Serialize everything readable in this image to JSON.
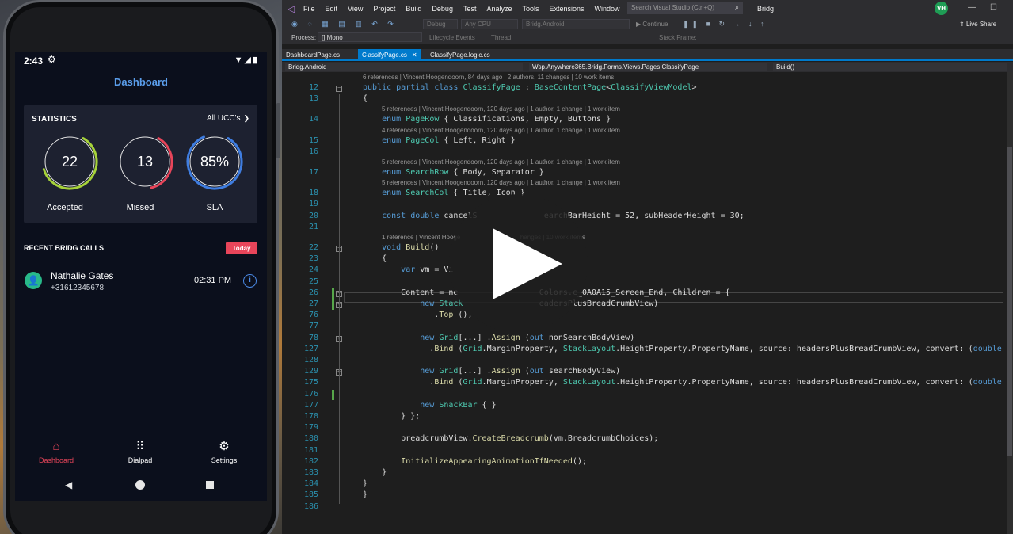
{
  "phone": {
    "status": {
      "time": "2:43",
      "signal_icons": "▼◢▮"
    },
    "app_title": "Dashboard",
    "statistics": {
      "title": "STATISTICS",
      "filter_label": "All UCC's",
      "gauges": [
        {
          "value": "22",
          "label": "Accepted",
          "fraction": 0.62,
          "color": "#a6d23a"
        },
        {
          "value": "13",
          "label": "Missed",
          "fraction": 0.38,
          "color": "#e8455a"
        },
        {
          "value": "85%",
          "label": "SLA",
          "fraction": 0.85,
          "color": "#3f7de0"
        }
      ]
    },
    "recent_calls": {
      "title": "RECENT BRIDG CALLS",
      "badge": "Today",
      "items": [
        {
          "name": "Nathalie Gates",
          "number": "+31612345678",
          "time": "02:31 PM"
        }
      ]
    },
    "nav": {
      "items": [
        {
          "label": "Dashboard",
          "icon": "home-icon"
        },
        {
          "label": "Dialpad",
          "icon": "dialpad-icon"
        },
        {
          "label": "Settings",
          "icon": "gear-icon"
        }
      ]
    }
  },
  "vs": {
    "menu": [
      "File",
      "Edit",
      "View",
      "Project",
      "Build",
      "Debug",
      "Test",
      "Analyze",
      "Tools",
      "Extensions",
      "Window",
      "Help"
    ],
    "search_placeholder": "Search Visual Studio (Ctrl+Q)",
    "solution_name": "Bridg",
    "user_initials": "VH",
    "toolbar": {
      "config": "Debug",
      "platform": "Any CPU",
      "project": "Bridg.Android",
      "continue": "Continue",
      "live_share": "Live Share"
    },
    "debugbar": {
      "process_label": "Process:",
      "process_value": "[] Mono",
      "lifecycle": "Lifecycle Events",
      "thread_label": "Thread:",
      "stack_frame": "Stack Frame:"
    },
    "tabs": [
      "DashboardPage.cs",
      "ClassifyPage.cs",
      "ClassifyPage.logic.cs"
    ],
    "active_tab": "ClassifyPage.cs",
    "navbar": {
      "project": "Bridg.Android",
      "type": "Wsp.Anywhere365.Bridg.Forms.Views.Pages.ClassifyPage",
      "member": "Build()"
    },
    "code": [
      {
        "kind": "lens",
        "text": "6 references | Vincent Hoogendoorn, 84 days ago | 2 authors, 11 changes | 10 work items",
        "indent": 0
      },
      {
        "kind": "code",
        "ln": "12",
        "text": "public partial class ClassifyPage : BaseContentPage<ClassifyViewModel>"
      },
      {
        "kind": "code",
        "ln": "13",
        "text": "{"
      },
      {
        "kind": "lens",
        "text": "5 references | Vincent Hoogendoorn, 120 days ago | 1 author, 1 change | 1 work item",
        "indent": 1
      },
      {
        "kind": "code",
        "ln": "14",
        "text": "    enum PageRow { Classifications, Empty, Buttons }"
      },
      {
        "kind": "lens",
        "text": "4 references | Vincent Hoogendoorn, 120 days ago | 1 author, 1 change | 1 work item",
        "indent": 1
      },
      {
        "kind": "code",
        "ln": "15",
        "text": "    enum PageCol { Left, Right }"
      },
      {
        "kind": "code",
        "ln": "16",
        "text": ""
      },
      {
        "kind": "lens",
        "text": "5 references | Vincent Hoogendoorn, 120 days ago | 1 author, 1 change | 1 work item",
        "indent": 1
      },
      {
        "kind": "code",
        "ln": "17",
        "text": "    enum SearchRow { Body, Separator }"
      },
      {
        "kind": "lens",
        "text": "5 references | Vincent Hoogendoorn, 120 days ago | 1 author, 1 change | 1 work item",
        "indent": 1
      },
      {
        "kind": "code",
        "ln": "18",
        "text": "    enum SearchCol { Title, Icon }"
      },
      {
        "kind": "code",
        "ln": "19",
        "text": ""
      },
      {
        "kind": "code",
        "ln": "20",
        "text": "    const double cancelS              earchBarHeight = 52, subHeaderHeight = 30;"
      },
      {
        "kind": "code",
        "ln": "21",
        "text": ""
      },
      {
        "kind": "lens",
        "text": "1 reference | Vincent Hooge                                  hanges | 10 work items",
        "indent": 1
      },
      {
        "kind": "code",
        "ln": "22",
        "text": "    void Build()"
      },
      {
        "kind": "code",
        "ln": "23",
        "text": "    {"
      },
      {
        "kind": "code",
        "ln": "24",
        "text": "        var vm = Vi"
      },
      {
        "kind": "code",
        "ln": "25",
        "text": ""
      },
      {
        "kind": "code",
        "ln": "26",
        "text": "        Content = ne                 Colors.c_0A0A15_Screen_End, Children = {"
      },
      {
        "kind": "code",
        "ln": "27",
        "text": "            new Stack                eadersPlusBreadCrumbView)"
      },
      {
        "kind": "code",
        "ln": "76",
        "text": "               .Top (),"
      },
      {
        "kind": "code",
        "ln": "77",
        "text": ""
      },
      {
        "kind": "code",
        "ln": "78",
        "text": "            new Grid[...] .Assign (out nonSearchBodyView)"
      },
      {
        "kind": "code",
        "ln": "127",
        "text": "              .Bind (Grid.MarginProperty, StackLayout.HeightProperty.PropertyName, source: headersPlusBreadCrumbView, convert: (double h"
      },
      {
        "kind": "code",
        "ln": "128",
        "text": ""
      },
      {
        "kind": "code",
        "ln": "129",
        "text": "            new Grid[...] .Assign (out searchBodyView)"
      },
      {
        "kind": "code",
        "ln": "175",
        "text": "              .Bind (Grid.MarginProperty, StackLayout.HeightProperty.PropertyName, source: headersPlusBreadCrumbView, convert: (double h"
      },
      {
        "kind": "code",
        "ln": "176",
        "text": ""
      },
      {
        "kind": "code",
        "ln": "177",
        "text": "            new SnackBar { }"
      },
      {
        "kind": "code",
        "ln": "178",
        "text": "        } };"
      },
      {
        "kind": "code",
        "ln": "179",
        "text": ""
      },
      {
        "kind": "code",
        "ln": "180",
        "text": "        breadcrumbView.CreateBreadcrumb(vm.BreadcrumbChoices);"
      },
      {
        "kind": "code",
        "ln": "181",
        "text": ""
      },
      {
        "kind": "code",
        "ln": "182",
        "text": "        InitializeAppearingAnimationIfNeeded();"
      },
      {
        "kind": "code",
        "ln": "183",
        "text": "    }"
      },
      {
        "kind": "code",
        "ln": "184",
        "text": "}"
      },
      {
        "kind": "code",
        "ln": "185",
        "text": "}"
      },
      {
        "kind": "code",
        "ln": "186",
        "text": ""
      }
    ]
  },
  "overlay": {
    "icon": "play-icon"
  }
}
